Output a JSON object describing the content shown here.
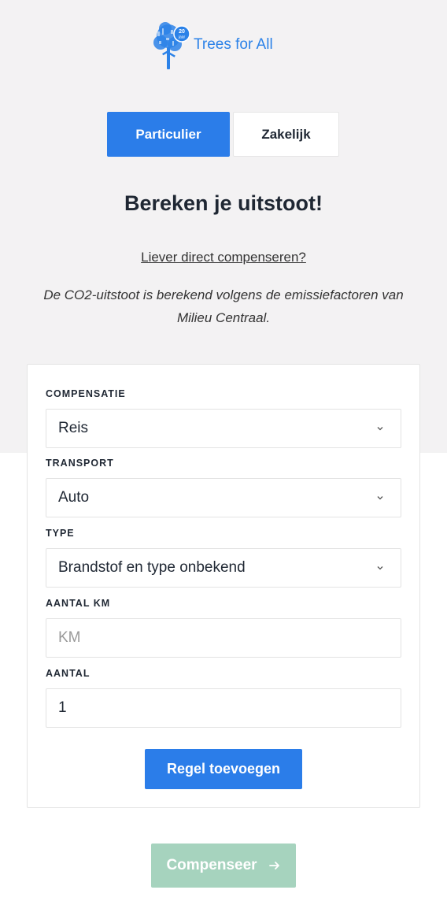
{
  "brand": {
    "name": "Trees for All",
    "badge_line1": "20",
    "badge_line2": "jaar"
  },
  "tabs": [
    {
      "label": "Particulier",
      "active": true
    },
    {
      "label": "Zakelijk",
      "active": false
    }
  ],
  "heading": "Bereken je uitstoot!",
  "direct_link": "Liever direct compenseren?",
  "note": "De CO2-uitstoot is berekend volgens de emissiefactoren van Milieu Centraal.",
  "form": {
    "compensatie": {
      "label": "COMPENSATIE",
      "value": "Reis"
    },
    "transport": {
      "label": "TRANSPORT",
      "value": "Auto"
    },
    "type": {
      "label": "TYPE",
      "value": "Brandstof en type onbekend"
    },
    "aantal_km": {
      "label": "AANTAL KM",
      "placeholder": "KM",
      "value": ""
    },
    "aantal": {
      "label": "AANTAL",
      "value": "1"
    },
    "add_button": "Regel toevoegen"
  },
  "compenseer_button": "Compenseer",
  "colors": {
    "primary": "#2b7de9",
    "disabled_green": "#a6d3be",
    "brand_blue": "#2b82e8"
  },
  "icons": {
    "select": "chevron-down-icon",
    "compenseer": "arrow-right-icon"
  }
}
